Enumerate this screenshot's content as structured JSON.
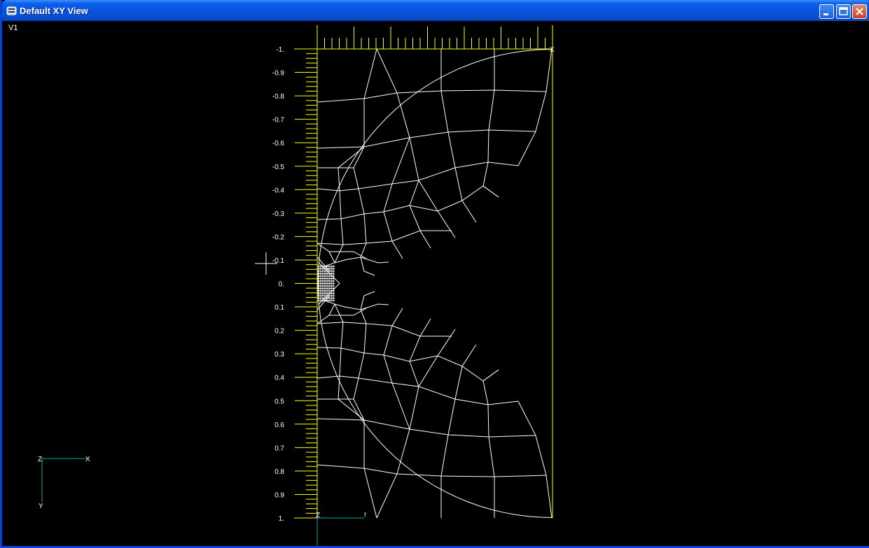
{
  "window": {
    "title": "Default XY View",
    "controls": {
      "minimize": "minimize",
      "maximize": "maximize",
      "close": "close"
    }
  },
  "viewport": {
    "label": "V1",
    "y_axis": {
      "color": "#ffff00",
      "tick_labels": [
        "-1.",
        "-0.9",
        "-0.8",
        "-0.7",
        "-0.6",
        "-0.5",
        "-0.4",
        "-0.3",
        "-0.2",
        "-0.1",
        "0.",
        "0.1",
        "0.2",
        "0.3",
        "0.4",
        "0.5",
        "0.6",
        "0.7",
        "0.8",
        "0.9",
        "1."
      ]
    },
    "triad": {
      "color": "#00aaaa",
      "labels": {
        "z": "Z",
        "x": "X",
        "y": "Y"
      }
    },
    "marker": {
      "corner_label": "X",
      "origin_label": "Z",
      "bottom_mark": "r"
    },
    "mesh_color": "#ffffff"
  }
}
